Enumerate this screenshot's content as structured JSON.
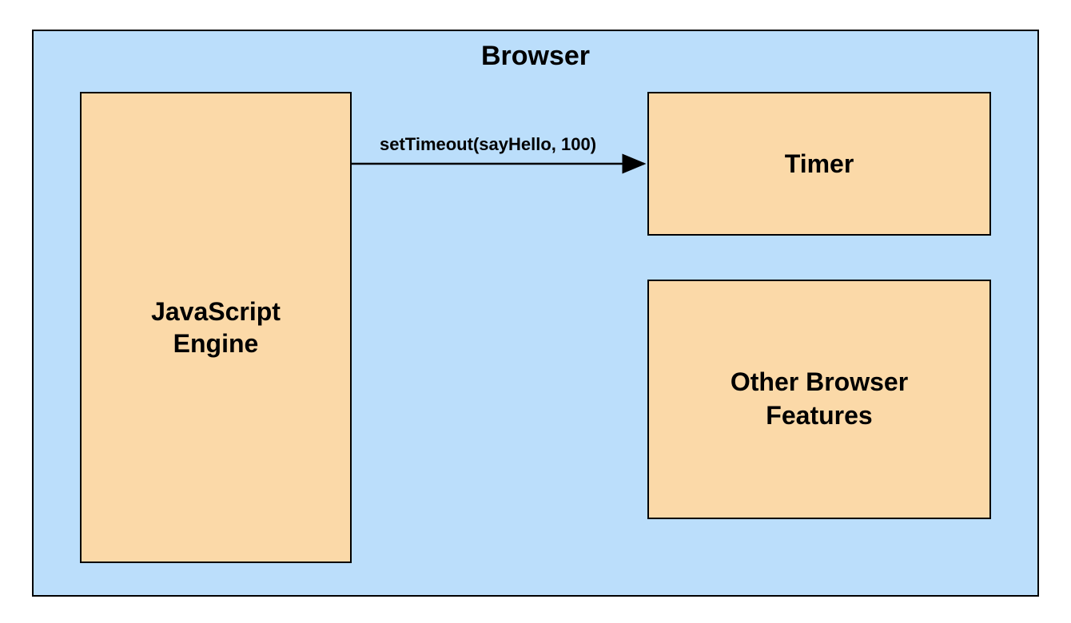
{
  "diagram": {
    "browser_title": "Browser",
    "js_engine_label": "JavaScript\nEngine",
    "timer_label": "Timer",
    "other_features_label": "Other Browser\nFeatures",
    "arrow_label": "setTimeout(sayHello, 100)"
  },
  "colors": {
    "browser_bg": "#bbdefb",
    "box_bg": "#fbd9a8",
    "stroke": "#000000"
  }
}
